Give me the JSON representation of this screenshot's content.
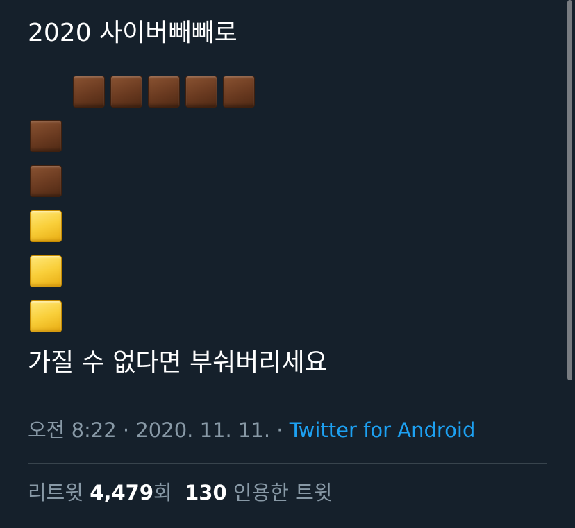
{
  "tweet": {
    "lines": [
      "2020 사이버빼빼로",
      "가질 수 없다면 부숴버리세요"
    ],
    "emoji": {
      "top_row": [
        "brown-square",
        "brown-square",
        "brown-square",
        "brown-square",
        "brown-square"
      ],
      "column": [
        "brown-square",
        "brown-square",
        "yellow-square",
        "yellow-square",
        "yellow-square"
      ],
      "colors": {
        "brown-square": "#6a3a20",
        "yellow-square": "#f9cf3a"
      }
    }
  },
  "meta": {
    "time": "오전 8:22",
    "separator": " · ",
    "date": "2020. 11. 11.",
    "separator2": " · ",
    "source": "Twitter for Android"
  },
  "stats": {
    "retweet_label": "리트윗 ",
    "retweet_count": "4,479",
    "retweet_unit": "회",
    "quote_count": "130",
    "quote_label": " 인용한 트윗"
  },
  "colors": {
    "background": "#15202b",
    "text": "#ffffff",
    "muted": "#8899a6",
    "link": "#1da1f2",
    "divider": "#38444d"
  }
}
